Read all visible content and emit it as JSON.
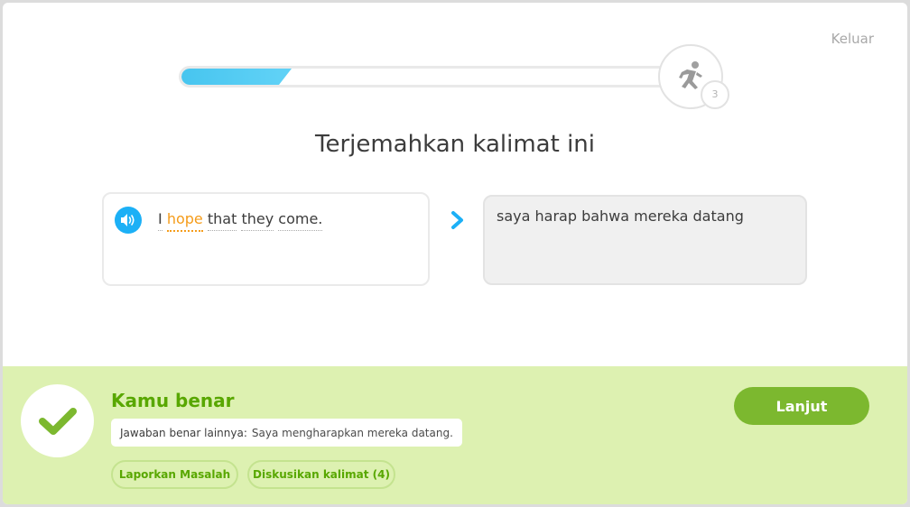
{
  "header": {
    "quit_label": "Keluar",
    "progress_value": 0.2,
    "runner_count": "3"
  },
  "exercise": {
    "instruction": "Terjemahkan kalimat ini",
    "prompt_words": [
      {
        "text": "I",
        "highlighted": false
      },
      {
        "text": "hope",
        "highlighted": true
      },
      {
        "text": "that",
        "highlighted": false
      },
      {
        "text": "they",
        "highlighted": false
      },
      {
        "text": "come.",
        "highlighted": false
      }
    ],
    "user_answer": "saya harap bahwa mereka datang"
  },
  "feedback": {
    "title": "Kamu benar",
    "alt_label": "Jawaban benar lainnya:",
    "alt_answer": "Saya mengharapkan mereka datang.",
    "report_label": "Laporkan Masalah",
    "discuss_label": "Diskusikan kalimat (4)",
    "continue_label": "Lanjut"
  },
  "colors": {
    "accent_blue": "#1cb0f6",
    "success_green": "#58a700",
    "button_green": "#7cb82f",
    "footer_bg": "#ddf1b1",
    "highlight_orange": "#f59c1a"
  },
  "icons": {
    "speaker": "speaker-icon",
    "arrow": "chevron-right-icon",
    "check": "check-icon",
    "runner": "runner-icon"
  }
}
